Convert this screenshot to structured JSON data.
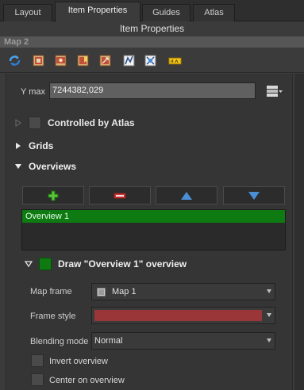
{
  "tabs": [
    {
      "label": "Layout"
    },
    {
      "label": "Item Properties"
    },
    {
      "label": "Guides"
    },
    {
      "label": "Atlas"
    }
  ],
  "panel_title": "Item Properties",
  "item_header": "Map 2",
  "toolbar": {
    "icons": [
      "refresh-icon",
      "set-extent-icon",
      "view-extent-icon",
      "bookmark-extent-icon",
      "move-content-icon",
      "zoom-extent-icon",
      "label-settings-icon"
    ]
  },
  "extent": {
    "ymax_label": "Y max",
    "ymax_value": "7244382,029"
  },
  "sections": {
    "controlled_by_atlas": "Controlled by Atlas",
    "grids": "Grids",
    "overviews": "Overviews"
  },
  "overviews": {
    "items": [
      "Overview 1"
    ],
    "draw_label": "Draw \"Overview 1\" overview",
    "map_frame_label": "Map frame",
    "map_frame_value": "Map 1",
    "frame_style_label": "Frame style",
    "frame_style_color": "#9b3638",
    "blending_mode_label": "Blending mode",
    "blending_mode_value": "Normal",
    "invert_label": "Invert overview",
    "center_label": "Center on overview"
  },
  "colors": {
    "accent_green": "#0f7a12",
    "add_icon": "#56c83a",
    "remove_icon": "#d43a3a",
    "arrow_blue": "#4a8fd6"
  }
}
